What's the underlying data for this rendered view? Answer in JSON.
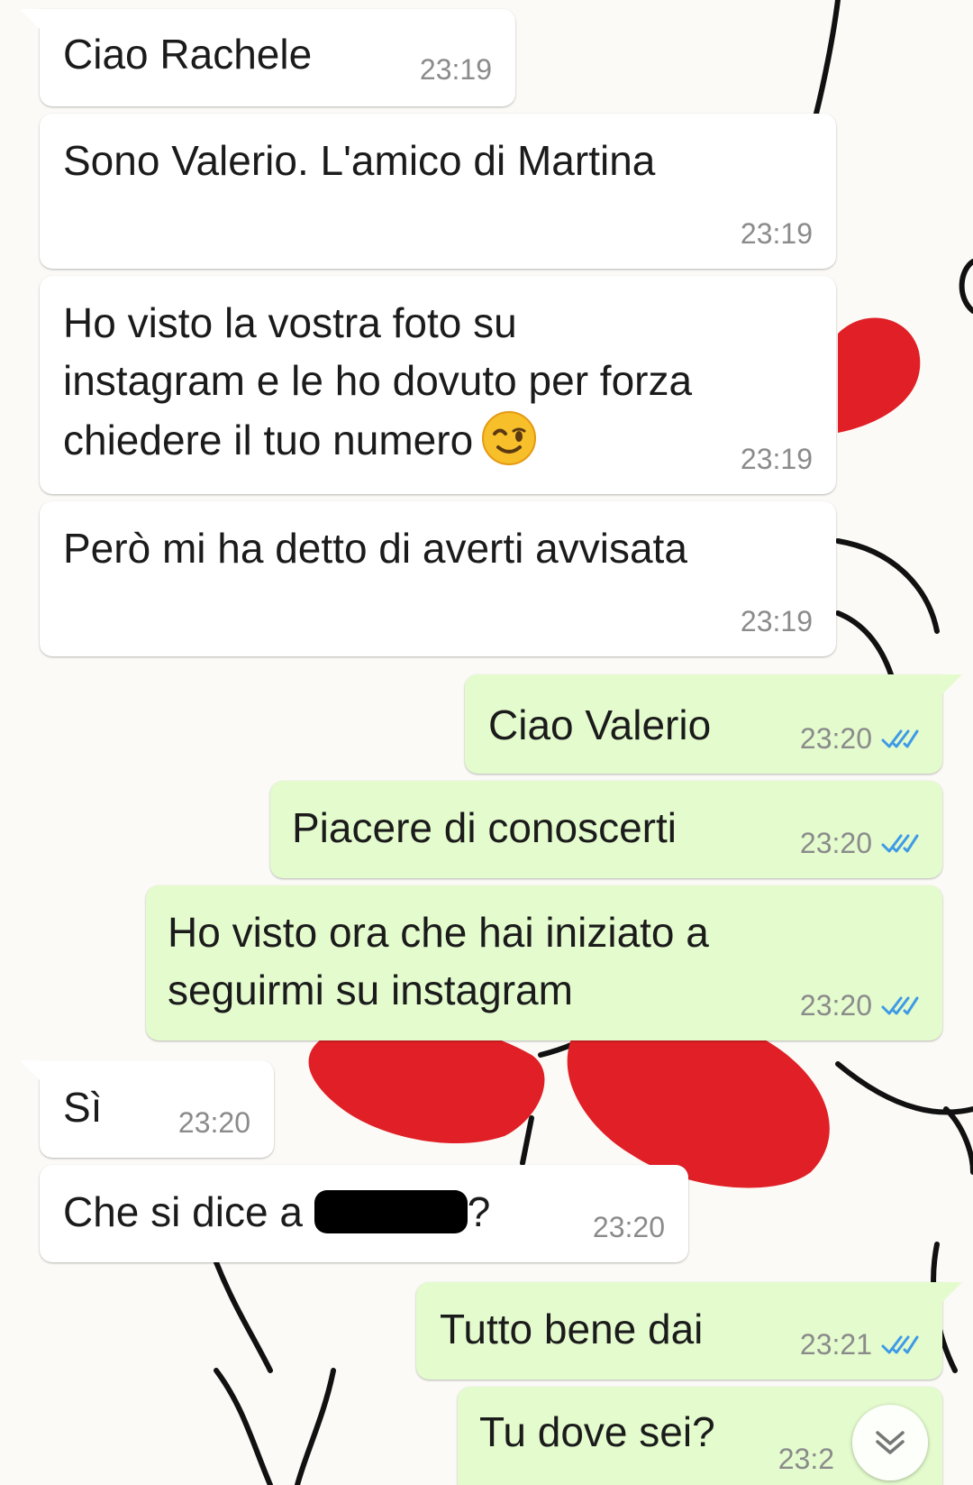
{
  "colors": {
    "incoming_bubble": "#ffffff",
    "outgoing_bubble": "#e3fbcd",
    "time_text": "#8b8b8b",
    "read_ticks": "#3f9ae6"
  },
  "messages": [
    {
      "direction": "incoming",
      "text": "Ciao Rachele",
      "time": "23:19"
    },
    {
      "direction": "incoming",
      "text": "Sono Valerio. L'amico di Martina",
      "time": "23:19"
    },
    {
      "direction": "incoming",
      "lines": [
        "Ho visto la vostra foto su",
        "instagram e le ho dovuto per forza",
        "chiedere il tuo numero"
      ],
      "emoji": "winking-face",
      "time": "23:19"
    },
    {
      "direction": "incoming",
      "text": "Però mi ha detto di averti avvisata",
      "time": "23:19"
    },
    {
      "direction": "outgoing",
      "text": "Ciao Valerio",
      "time": "23:20",
      "status": "read"
    },
    {
      "direction": "outgoing",
      "text": "Piacere di conoscerti",
      "time": "23:20",
      "status": "read"
    },
    {
      "direction": "outgoing",
      "lines": [
        "Ho visto ora che hai iniziato a",
        "seguirmi su instagram"
      ],
      "time": "23:20",
      "status": "read"
    },
    {
      "direction": "incoming",
      "text": "Sì",
      "time": "23:20"
    },
    {
      "direction": "incoming",
      "text_before": "Che si dice a",
      "redacted": true,
      "text_after": "?",
      "time": "23:20"
    },
    {
      "direction": "outgoing",
      "text": "Tutto bene dai",
      "time": "23:21",
      "status": "read"
    },
    {
      "direction": "outgoing",
      "text": "Tu dove sei?",
      "time": "23:2",
      "status": "read"
    }
  ],
  "scroll_button": {
    "icon": "double-chevron-down-icon"
  }
}
